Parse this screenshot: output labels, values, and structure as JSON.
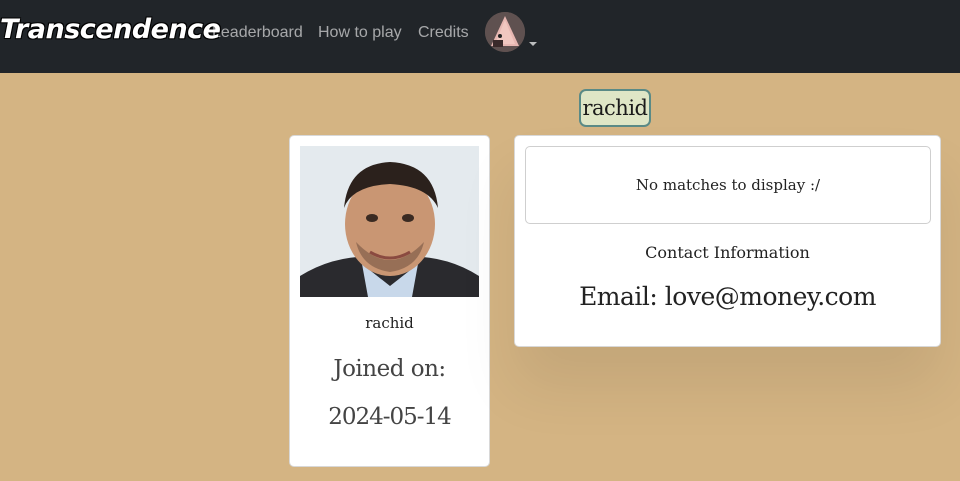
{
  "navbar": {
    "brand": "Transcendence",
    "links": [
      "Leaderboard",
      "How to play",
      "Credits"
    ],
    "avatar_icon": "user-avatar"
  },
  "profile": {
    "username": "rachid",
    "name": "rachid",
    "joined_label": "Joined on:",
    "joined_date": "2024-05-14"
  },
  "matches": {
    "empty_text": "No matches to display :/"
  },
  "contact": {
    "title": "Contact Information",
    "email": "Email: love@money.com"
  },
  "colors": {
    "navbar_bg": "#212529",
    "page_bg": "#d4b483",
    "badge_bg": "#dfe6c6",
    "badge_border": "#5a8a86"
  }
}
